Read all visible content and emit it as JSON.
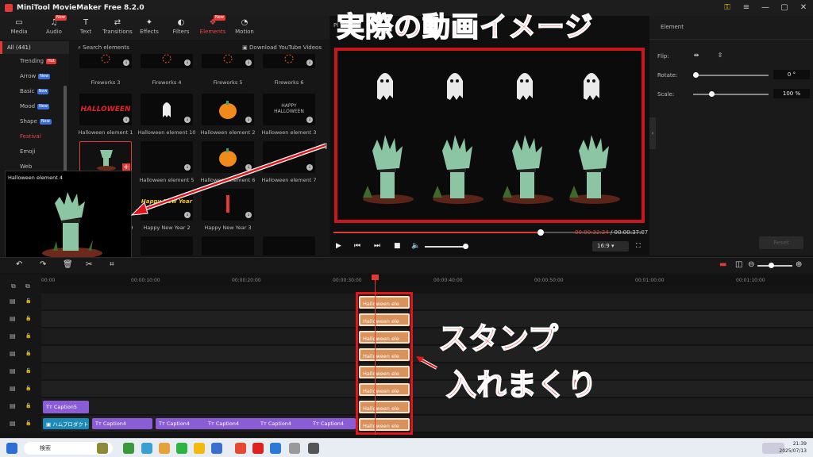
{
  "app": {
    "title": "MiniTool MovieMaker Free 8.2.0"
  },
  "toolbar": {
    "tabs": [
      {
        "label": "Media",
        "icon": "folder-icon",
        "badge": ""
      },
      {
        "label": "Audio",
        "icon": "music-note-icon",
        "badge": "New"
      },
      {
        "label": "Text",
        "icon": "text-icon",
        "badge": ""
      },
      {
        "label": "Transitions",
        "icon": "transition-icon",
        "badge": ""
      },
      {
        "label": "Effects",
        "icon": "effects-icon",
        "badge": ""
      },
      {
        "label": "Filters",
        "icon": "filters-icon",
        "badge": ""
      },
      {
        "label": "Elements",
        "icon": "elements-icon",
        "badge": "New"
      },
      {
        "label": "Motion",
        "icon": "motion-icon",
        "badge": ""
      }
    ]
  },
  "nav": {
    "header": "All (441)",
    "items": [
      {
        "label": "Trending",
        "badge": "Hot"
      },
      {
        "label": "Arrow",
        "badge": "New"
      },
      {
        "label": "Basic",
        "badge": "New"
      },
      {
        "label": "Mood",
        "badge": "New"
      },
      {
        "label": "Shape",
        "badge": "New"
      },
      {
        "label": "Festival",
        "badge": ""
      },
      {
        "label": "Emoji",
        "badge": ""
      },
      {
        "label": "Web",
        "badge": ""
      }
    ]
  },
  "library": {
    "search": "Search elements",
    "download": "Download YouTube Videos",
    "tiles": [
      "Fireworks 3",
      "Fireworks 4",
      "Fireworks 5",
      "Fireworks 6",
      "Halloween element 1",
      "Halloween element 10",
      "Halloween element 2",
      "Halloween element 3",
      "",
      "Halloween element 5",
      "Halloween element 6",
      "Halloween element 7",
      "Halloween element 9",
      "Happy New Year 2",
      "Happy New Year 3"
    ],
    "tile_texts": {
      "halloween": "HALLOWEEN",
      "happy_halloween": "HAPPY\nHALLOWEEN",
      "new_year": "Happy New Year"
    }
  },
  "popup": {
    "label": "Halloween element 4"
  },
  "player": {
    "header": "Pl",
    "current": "00:00:32:24",
    "total": "/ 00:00:37:07",
    "ratio": "16:9",
    "progress": 0.67
  },
  "overlay": {
    "title": "実際の動画イメージ",
    "right_line1": "スタンプ",
    "right_line2": "入れまくり"
  },
  "props": {
    "tab": "Element",
    "flip": "Flip:",
    "rotate": "Rotate:",
    "rotate_val": "0 °",
    "scale": "Scale:",
    "scale_val": "100 %",
    "reset": "Reset"
  },
  "timeline": {
    "ticks": [
      "00:00",
      "00:00:10:00",
      "00:00:20:00",
      "00:00:30:00",
      "00:00:40:00",
      "00:00:50:00",
      "00:01:00:00",
      "00:01:10:00"
    ],
    "element_label": "Halloween ele",
    "caption5": "Caption5",
    "caption4": "Caption4",
    "main_clip": "ハムプロダクト"
  },
  "taskbar": {
    "search": "検索",
    "time": "21:39",
    "date": "2025/07/13"
  },
  "colors": {
    "accent": "#e53935",
    "stage_border": "#c8161d",
    "element_clip": "#d9925b",
    "caption_clip": "#8a5cd6"
  }
}
